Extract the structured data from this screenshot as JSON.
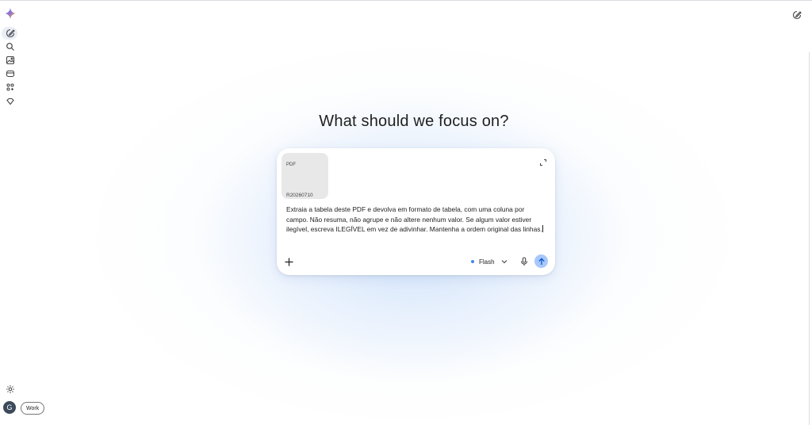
{
  "header": {
    "new_chat_icon": "edit-icon"
  },
  "sidebar": {
    "logo_icon": "gemini-sparkle-icon",
    "items": [
      {
        "icon": "new-chat-icon"
      },
      {
        "icon": "search-icon"
      },
      {
        "icon": "image-icon"
      },
      {
        "icon": "canvas-icon"
      },
      {
        "icon": "apps-icon"
      },
      {
        "icon": "gem-icon"
      }
    ],
    "settings_icon": "settings-icon"
  },
  "main": {
    "heading": "What should we focus on?"
  },
  "composer": {
    "attachment": {
      "type": "PDF",
      "name": "R20260710"
    },
    "prompt": "Extraia a tabela deste PDF e devolva em formato de tabela, com uma coluna por campo. Não resuma, não agrupe e não altere nenhum valor. Se algum valor estiver ilegível, escreva ILEGÍVEL em vez de adivinhar. Mantenha a ordem original das linhas.",
    "model": "Flash"
  },
  "account": {
    "avatar_initial": "G",
    "workspace_label": "Work"
  },
  "colors": {
    "accent": "#4285f4",
    "send_button": "#a8c7fa",
    "avatar_bg": "#3c4a5c"
  }
}
